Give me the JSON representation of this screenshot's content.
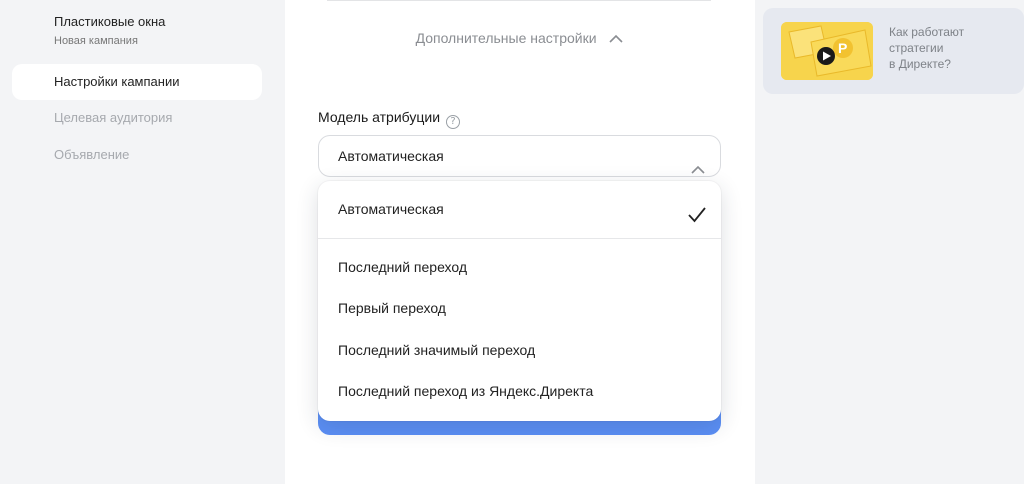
{
  "sidebar": {
    "campaign_title": "Пластиковые окна",
    "campaign_subtitle": "Новая кампания",
    "items": [
      {
        "label": "Настройки кампании",
        "active": true
      },
      {
        "label": "Целевая аудитория",
        "active": false
      },
      {
        "label": "Объявление",
        "active": false
      }
    ]
  },
  "main": {
    "more_settings_label": "Дополнительные настройки",
    "attribution_label": "Модель атрибуции",
    "help_glyph": "?",
    "select_value": "Автоматическая",
    "options": [
      {
        "label": "Автоматическая",
        "selected": true
      },
      {
        "label": "Последний переход",
        "selected": false
      },
      {
        "label": "Первый переход",
        "selected": false
      },
      {
        "label": "Последний значимый переход",
        "selected": false
      },
      {
        "label": "Последний переход из Яндекс.Директа",
        "selected": false
      }
    ]
  },
  "promo": {
    "text_line1": "Как работают",
    "text_line2": "стратегии",
    "text_line3": "в Директе?"
  },
  "colors": {
    "accent_blue": "#5b8ff5",
    "promo_yellow": "#f7d44c",
    "sidebar_bg": "#f3f4f6"
  },
  "icons": [
    "help-icon",
    "chevron-up-icon",
    "checkmark-icon",
    "play-icon"
  ]
}
